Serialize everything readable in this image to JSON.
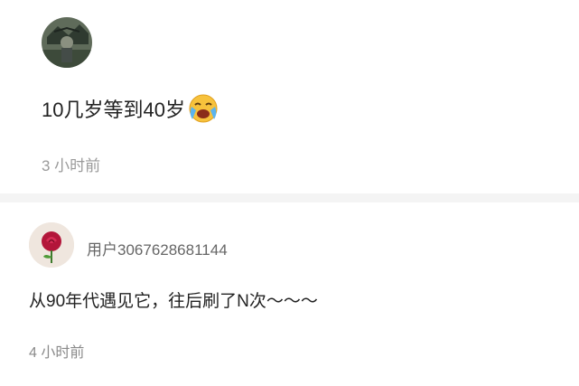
{
  "comments": [
    {
      "text": "10几岁等到40岁",
      "emoji_icon": "crying-face-icon",
      "time": "3 小时前"
    },
    {
      "username": "用户3067628681144",
      "text": "从90年代遇见它，往后刷了N次～～～",
      "time": "4 小时前"
    }
  ],
  "colors": {
    "text": "#222222",
    "meta": "#9a9a9a",
    "divider": "#f4f4f4"
  }
}
